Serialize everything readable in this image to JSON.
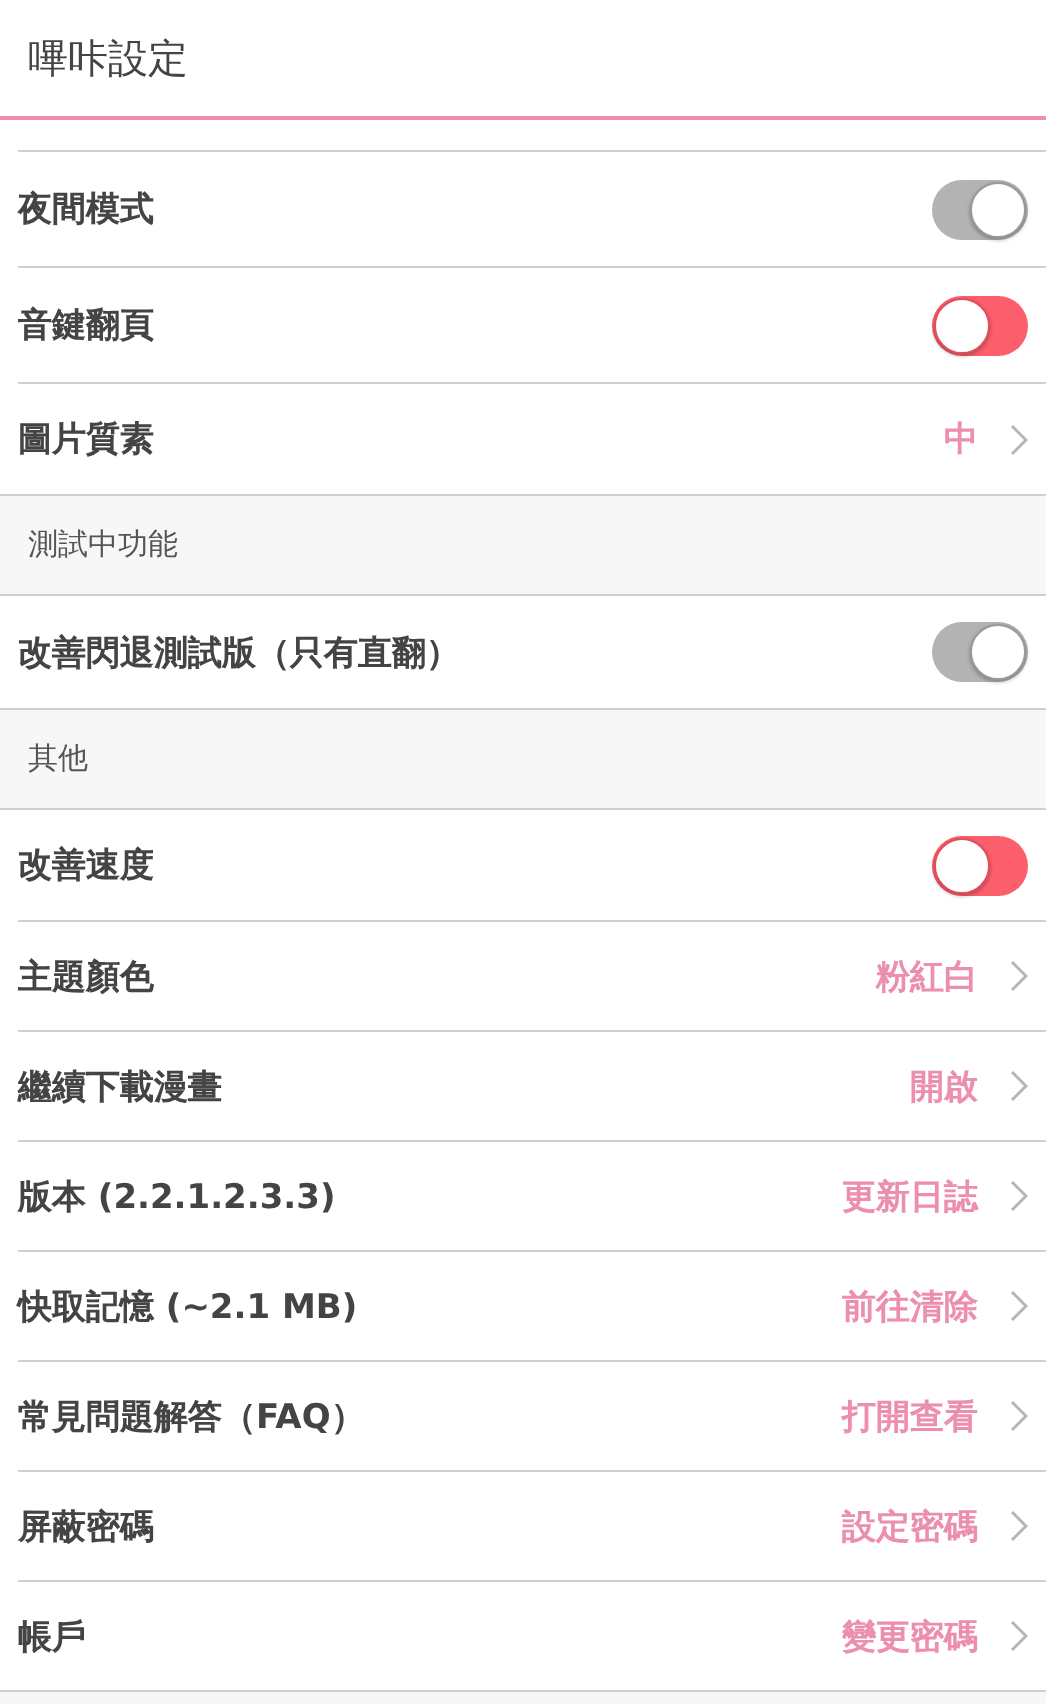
{
  "title": "嗶咔設定",
  "sections": [
    {
      "items": [
        {
          "kind": "toggle",
          "label": "夜間模式",
          "on": true
        },
        {
          "kind": "toggle",
          "label": "音鍵翻頁",
          "on": false
        },
        {
          "kind": "link",
          "label": "圖片質素",
          "value": "中"
        }
      ]
    },
    {
      "header": "測試中功能",
      "items": [
        {
          "kind": "toggle",
          "label": "改善閃退測試版（只有直翻）",
          "on": true
        }
      ]
    },
    {
      "header": "其他",
      "items": [
        {
          "kind": "toggle",
          "label": "改善速度",
          "on": false
        },
        {
          "kind": "link",
          "label": "主題顏色",
          "value": "粉紅白"
        },
        {
          "kind": "link",
          "label": "繼續下載漫畫",
          "value": "開啟"
        },
        {
          "kind": "link",
          "label": "版本 (2.2.1.2.3.3)",
          "value": "更新日誌"
        },
        {
          "kind": "link",
          "label": "快取記憶 (~2.1 MB)",
          "value": "前往清除"
        },
        {
          "kind": "link",
          "label": "常見問題解答（FAQ）",
          "value": "打開查看"
        },
        {
          "kind": "link",
          "label": "屏蔽密碼",
          "value": "設定密碼"
        },
        {
          "kind": "link",
          "label": "帳戶",
          "value": "變更密碼"
        }
      ]
    }
  ]
}
